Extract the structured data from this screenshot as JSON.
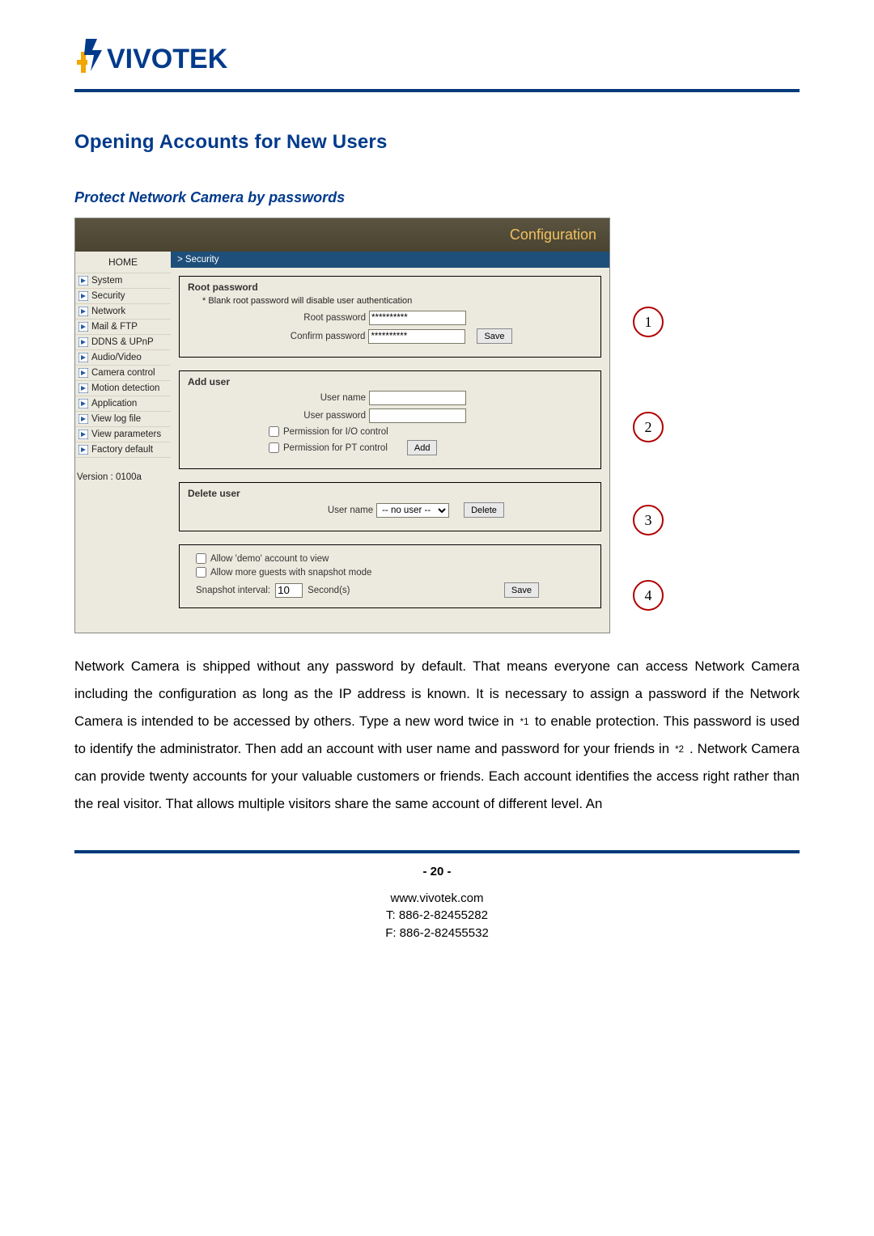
{
  "logo": {
    "brand": "VIVOTEK"
  },
  "section_title": "Opening Accounts for New Users",
  "subsection_title": "Protect Network Camera by passwords",
  "screenshot": {
    "conf_title": "Configuration",
    "breadcrumb": "> Security",
    "sidebar": {
      "home": "HOME",
      "items": [
        "System",
        "Security",
        "Network",
        "Mail & FTP",
        "DDNS & UPnP",
        "Audio/Video",
        "Camera control",
        "Motion detection",
        "Application",
        "View log file",
        "View parameters",
        "Factory default"
      ],
      "version": "Version : 0100a"
    },
    "panel1": {
      "title": "Root password",
      "note": "* Blank root password will disable user authentication",
      "root_pw_label": "Root password",
      "root_pw_value": "**********",
      "confirm_pw_label": "Confirm password",
      "confirm_pw_value": "**********",
      "save_label": "Save"
    },
    "panel2": {
      "title": "Add user",
      "username_label": "User name",
      "userpw_label": "User password",
      "perm_io": "Permission for I/O control",
      "perm_pt": "Permission for PT control",
      "add_label": "Add"
    },
    "panel3": {
      "title": "Delete user",
      "username_label": "User name",
      "select_value": "-- no user --",
      "delete_label": "Delete"
    },
    "panel4": {
      "allow_demo": "Allow 'demo' account to view",
      "allow_guests": "Allow more guests with snapshot mode",
      "snapshot_interval_label": "Snapshot interval:",
      "snapshot_interval_value": "10",
      "snapshot_unit": "Second(s)",
      "save_label": "Save"
    },
    "callouts": [
      "1",
      "2",
      "3",
      "4"
    ]
  },
  "body_paragraph": {
    "p1_a": "Network Camera is shipped without any password by default. That means everyone can access Network Camera including the configuration as long as the IP address is known. It is necessary to assign a password if the Network Camera is intended to be accessed by others. Type a new word twice in ",
    "ref1": "*1",
    "p1_b": " to enable protection. This password is used to identify the administrator. Then add an account with user name and password for your friends in ",
    "ref2": "*2",
    "p1_c": " . Network Camera can provide twenty accounts for your valuable customers or friends. Each account identifies the access right rather than the real visitor. That allows multiple visitors share the same account of different level.   An"
  },
  "page_number": "- 20 -",
  "footer": {
    "url": "www.vivotek.com",
    "tel": "T: 886-2-82455282",
    "fax": "F: 886-2-82455532"
  }
}
